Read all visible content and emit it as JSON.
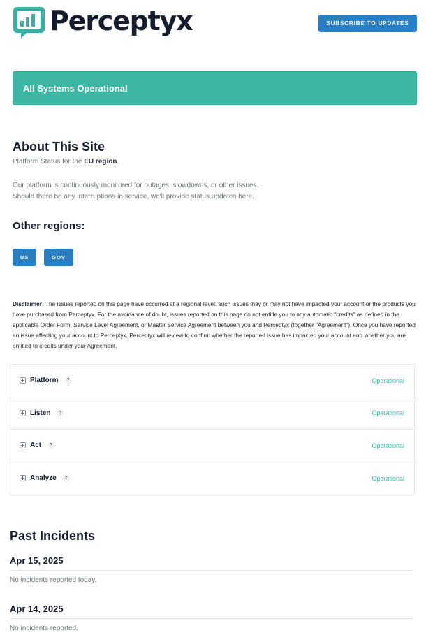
{
  "brand": {
    "name": "Perceptyx",
    "colors": {
      "accent": "#2a7fc2",
      "operational": "#3db6a4",
      "logo_dark": "#141c2e",
      "logo_teal": "#3aaea0"
    }
  },
  "header": {
    "subscribe_label": "SUBSCRIBE TO UPDATES"
  },
  "status_banner": {
    "text": "All Systems Operational"
  },
  "about": {
    "title": "About This Site",
    "subtitle_prefix": "Platform Status for the ",
    "subtitle_region": "EU region",
    "subtitle_suffix": ".",
    "description_line1": "Our platform is continuously monitored for outages, slowdowns, or other issues.",
    "description_line2": "Should there be any interruptions in service, we'll provide status updates here."
  },
  "other_regions": {
    "title": "Other regions:",
    "buttons": [
      {
        "label": "US"
      },
      {
        "label": "GOV"
      }
    ]
  },
  "disclaimer": {
    "label": "Disclaimer:",
    "text": " The issues reported on this page have occurred at a regional level; such issues may or may not have impacted your account or the products you have purchased from Perceptyx. For the avoidance of doubt, issues reported on this page do not entitle you to any automatic \"credits\" as defined in the applicable Order Form, Service Level Agreement, or Master Service Agreement between you and Perceptyx (together \"Agreement\"). Once you have reported an issue affecting your account to Perceptyx, Perceptyx will review to confirm whether the reported issue has impacted your account and whether you are entitled to credits under your Agreement."
  },
  "components": [
    {
      "name": "Platform",
      "help": "?",
      "status": "Operational"
    },
    {
      "name": "Listen",
      "help": "?",
      "status": "Operational"
    },
    {
      "name": "Act",
      "help": "?",
      "status": "Operational"
    },
    {
      "name": "Analyze",
      "help": "?",
      "status": "Operational"
    }
  ],
  "past_incidents": {
    "title": "Past Incidents",
    "days": [
      {
        "date": "Apr 15, 2025",
        "text": "No incidents reported today."
      },
      {
        "date": "Apr 14, 2025",
        "text": "No incidents reported."
      }
    ]
  }
}
